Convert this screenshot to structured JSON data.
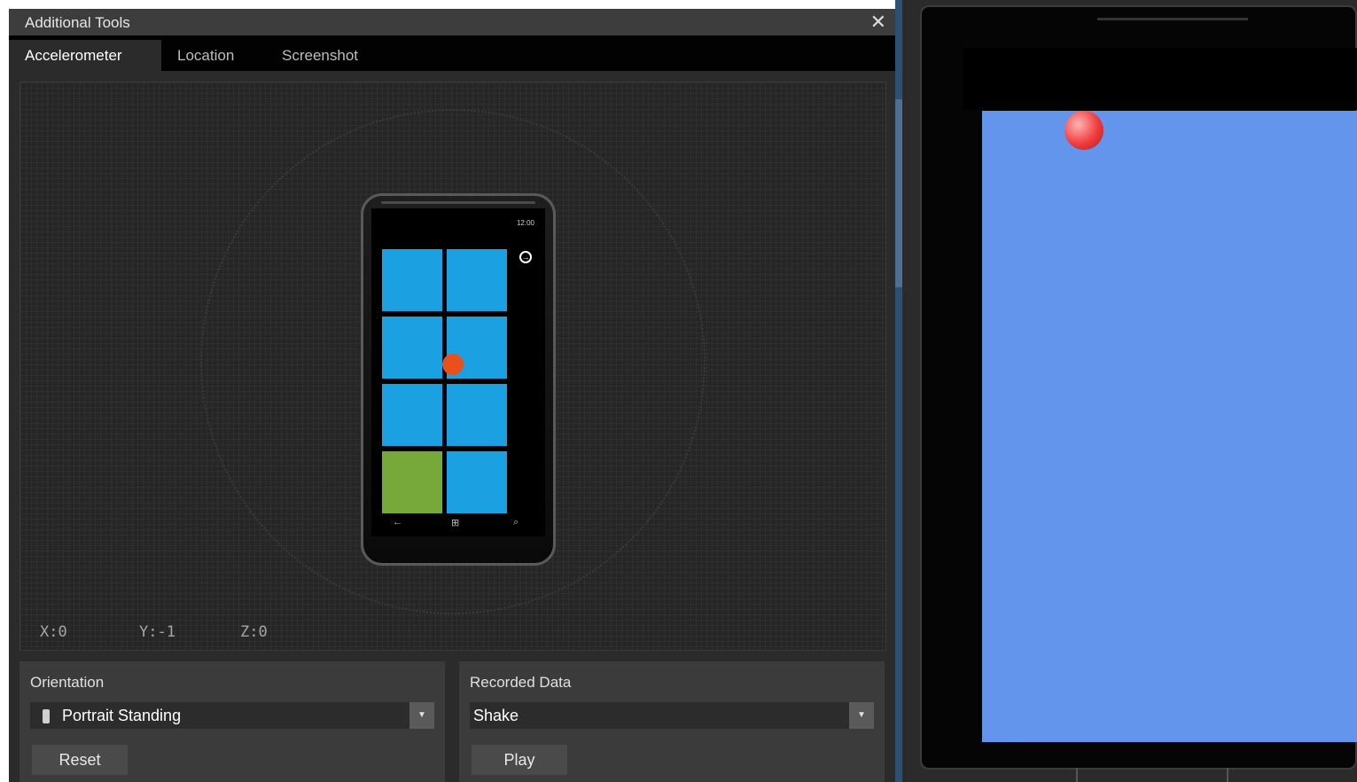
{
  "window": {
    "title": "Additional Tools",
    "close_icon": "close-icon"
  },
  "tabs": [
    {
      "label": "Accelerometer",
      "active": true
    },
    {
      "label": "Location",
      "active": false
    },
    {
      "label": "Screenshot",
      "active": false
    }
  ],
  "simulator": {
    "phone_clock": "12:00",
    "nav_icons": [
      "back-icon",
      "windows-icon",
      "search-icon"
    ],
    "tile_colors": [
      "#1ba1e2",
      "#76a83a"
    ],
    "dot_color": "#e8501c",
    "readouts": {
      "x": "X:0",
      "y": "Y:-1",
      "z": "Z:0"
    }
  },
  "orientation": {
    "label": "Orientation",
    "selected": "Portrait Standing",
    "reset_label": "Reset"
  },
  "recorded_data": {
    "label": "Recorded Data",
    "selected": "Shake",
    "play_label": "Play"
  },
  "emulator": {
    "canvas_color": "#6495ed",
    "ball_color": "#f03c3c"
  }
}
